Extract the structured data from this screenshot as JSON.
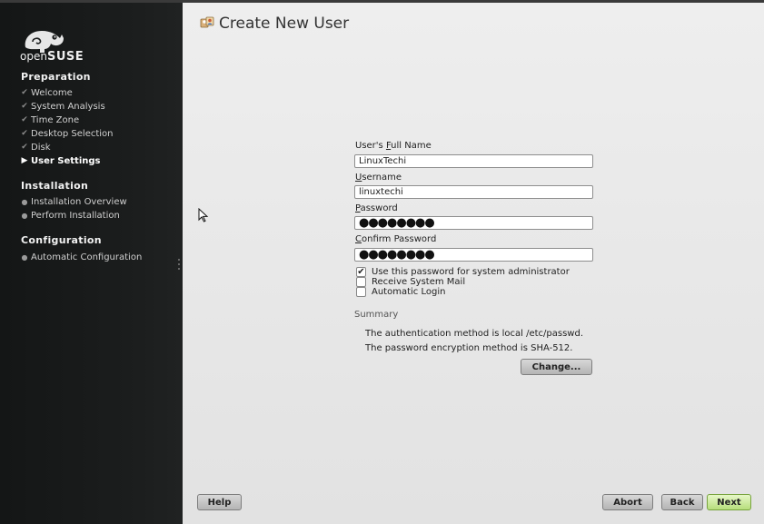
{
  "brand": {
    "logo_prefix": "open",
    "logo_main": "SUSE"
  },
  "sidebar": {
    "sections": [
      {
        "title": "Preparation",
        "steps": [
          {
            "label": "Welcome",
            "state": "done"
          },
          {
            "label": "System Analysis",
            "state": "done"
          },
          {
            "label": "Time Zone",
            "state": "done"
          },
          {
            "label": "Desktop Selection",
            "state": "done"
          },
          {
            "label": "Disk",
            "state": "done"
          },
          {
            "label": "User Settings",
            "state": "current"
          }
        ]
      },
      {
        "title": "Installation",
        "steps": [
          {
            "label": "Installation Overview",
            "state": "pending"
          },
          {
            "label": "Perform Installation",
            "state": "pending"
          }
        ]
      },
      {
        "title": "Configuration",
        "steps": [
          {
            "label": "Automatic Configuration",
            "state": "pending"
          }
        ]
      }
    ]
  },
  "page": {
    "title": "Create New User"
  },
  "form": {
    "full_name": {
      "label_pre": "User's ",
      "label_key": "F",
      "label_post": "ull Name",
      "value": "LinuxTechi"
    },
    "username": {
      "label_pre": "",
      "label_key": "U",
      "label_post": "sername",
      "value": "linuxtechi"
    },
    "password": {
      "label_pre": "",
      "label_key": "P",
      "label_post": "assword",
      "value": "●●●●●●●●"
    },
    "confirm_password": {
      "label_pre": "",
      "label_key": "C",
      "label_post": "onfirm Password",
      "value": "●●●●●●●●"
    },
    "checkboxes": [
      {
        "label": "Use this password for system administrator",
        "checked": true
      },
      {
        "label": "Receive System Mail",
        "checked": false
      },
      {
        "label": "Automatic Login",
        "checked": false
      }
    ]
  },
  "summary": {
    "label": "Summary",
    "lines": [
      "The authentication method is local /etc/passwd.",
      "The password encryption method is SHA-512."
    ],
    "change_button": "Change..."
  },
  "footer": {
    "help": "Help",
    "abort": "Abort",
    "back": "Back",
    "next": "Next"
  },
  "colors": {
    "sidebar_bg": "#1b1d1d",
    "main_bg": "#e8e8e8",
    "next_button": "#b6de7c"
  },
  "icons": {
    "step_done": "check-icon",
    "step_current": "arrow-right-icon",
    "step_pending": "bullet-icon",
    "title": "users-icon",
    "logo": "chameleon-logo"
  }
}
